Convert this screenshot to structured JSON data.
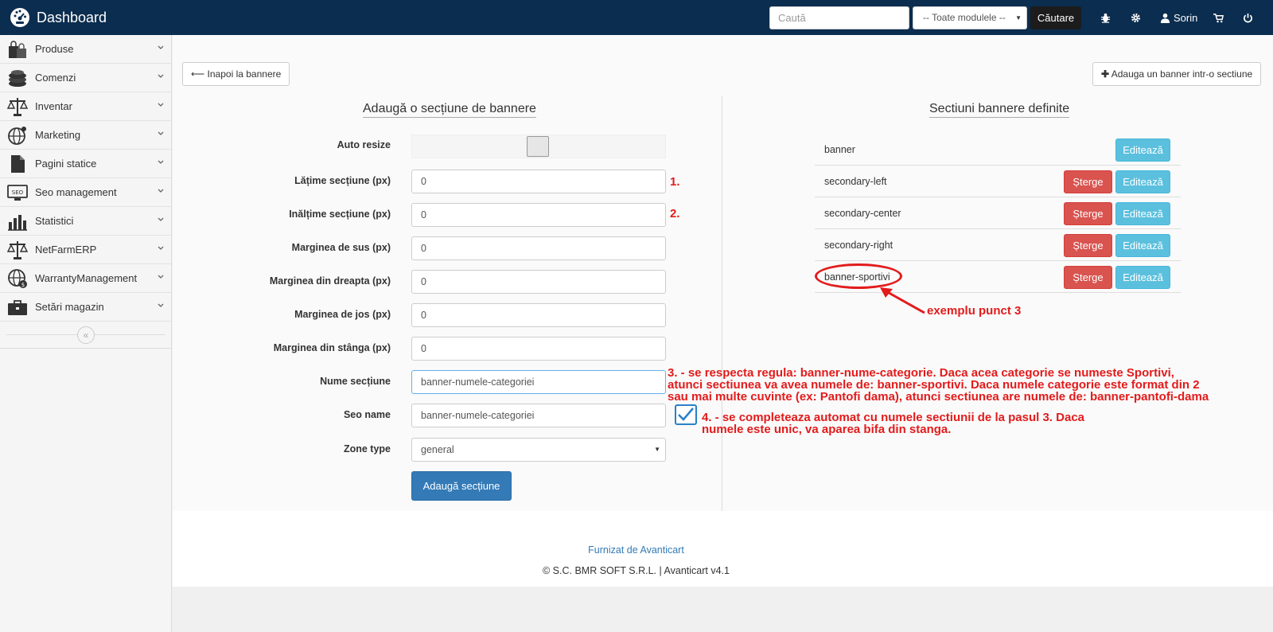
{
  "topbar": {
    "brand": "Dashboard",
    "search_placeholder": "Caută",
    "module_select": "-- Toate modulele --",
    "search_button": "Căutare",
    "user_name": "Sorin"
  },
  "sidebar": {
    "items": [
      {
        "label": "Produse",
        "icon": "shopping-bags-icon"
      },
      {
        "label": "Comenzi",
        "icon": "coins-icon"
      },
      {
        "label": "Inventar",
        "icon": "scales-icon"
      },
      {
        "label": "Marketing",
        "icon": "globe-icon"
      },
      {
        "label": "Pagini statice",
        "icon": "document-icon"
      },
      {
        "label": "Seo management",
        "icon": "seo-monitor-icon"
      },
      {
        "label": "Statistici",
        "icon": "bar-chart-icon"
      },
      {
        "label": "NetFarmERP",
        "icon": "scales-icon"
      },
      {
        "label": "WarrantyManagement",
        "icon": "globe-dollar-icon"
      },
      {
        "label": "Setări magazin",
        "icon": "briefcase-icon"
      }
    ]
  },
  "actions": {
    "back": "Inapoi la bannere",
    "add_banner": "Adauga un banner intr-o sectiune"
  },
  "form": {
    "title": "Adaugă o secțiune de bannere",
    "auto_resize_label": "Auto resize",
    "width_label": "Lățime secțiune (px)",
    "width_value": "0",
    "height_label": "Inălțime secțiune (px)",
    "height_value": "0",
    "margin_top_label": "Marginea de sus (px)",
    "margin_top_value": "0",
    "margin_right_label": "Marginea din dreapta (px)",
    "margin_right_value": "0",
    "margin_bottom_label": "Marginea de jos (px)",
    "margin_bottom_value": "0",
    "margin_left_label": "Marginea din stânga (px)",
    "margin_left_value": "0",
    "section_name_label": "Nume secțiune",
    "section_name_value": "banner-numele-categoriei",
    "seo_name_label": "Seo name",
    "seo_name_value": "banner-numele-categoriei",
    "zone_type_label": "Zone type",
    "zone_type_value": "general",
    "submit": "Adaugă secțiune"
  },
  "sections": {
    "title": "Sectiuni bannere definite",
    "delete_label": "Șterge",
    "edit_label": "Editează",
    "rows": [
      {
        "name": "banner"
      },
      {
        "name": "secondary-left"
      },
      {
        "name": "secondary-center"
      },
      {
        "name": "secondary-right"
      },
      {
        "name": "banner-sportivi"
      }
    ]
  },
  "annotations": {
    "num1": "1.",
    "num2": "2.",
    "note3_line1": "3. - se respecta regula: banner-nume-categorie. Daca acea categorie se numeste Sportivi,",
    "note3_line2": "atunci sectiunea va avea numele de: banner-sportivi. Daca numele categorie este format din 2",
    "note3_line3": "sau mai multe cuvinte (ex: Pantofi dama), atunci sectiunea are numele de: banner-pantofi-dama",
    "note4_line1": "4. - se completeaza automat cu numele sectiunii de la pasul 3. Daca",
    "note4_line2": "numele este unic, va aparea bifa din stanga.",
    "example": "exemplu punct 3"
  },
  "footer": {
    "powered": "Furnizat de Avanticart",
    "copyright": "© S.C. BMR SOFT S.R.L. | Avanticart v4.1"
  },
  "colors": {
    "topbar": "#0b2d4f",
    "primary": "#337ab7",
    "danger": "#d9534f",
    "info": "#5bc0de",
    "annotation": "#e31b1b"
  }
}
